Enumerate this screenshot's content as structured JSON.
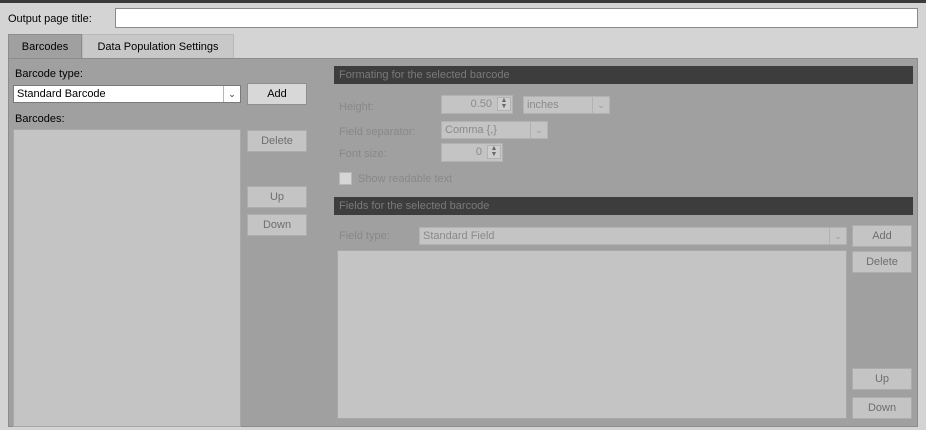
{
  "header": {
    "title_label": "Output page title:",
    "title_value": ""
  },
  "tabs": [
    {
      "label": "Barcodes",
      "active": true
    },
    {
      "label": "Data Population Settings",
      "active": false
    }
  ],
  "left": {
    "barcode_type_label": "Barcode type:",
    "barcode_type_value": "Standard Barcode",
    "barcodes_label": "Barcodes:",
    "add_label": "Add",
    "delete_label": "Delete",
    "up_label": "Up",
    "down_label": "Down"
  },
  "formatting": {
    "header": "Formating for the selected barcode",
    "height_label": "Height:",
    "height_value": "0.50",
    "unit_value": "inches",
    "separator_label": "Field separator:",
    "separator_value": "Comma {,}",
    "font_size_label": "Font size:",
    "font_size_value": "0",
    "show_readable_label": "Show readable text",
    "show_readable_checked": false
  },
  "fields": {
    "header": "Fields for the selected barcode",
    "field_type_label": "Field type:",
    "field_type_value": "Standard Field",
    "add_label": "Add",
    "delete_label": "Delete",
    "up_label": "Up",
    "down_label": "Down"
  },
  "icons": {
    "dropdown": "chevron-down-icon",
    "spinner": "spinner-arrows-icon"
  },
  "colors": {
    "window_bg": "#d4d4d4",
    "panel_bg": "#a0a0a0",
    "section_header_bg": "#3d3d3d",
    "disabled_control_bg": "#c4c4c4"
  }
}
